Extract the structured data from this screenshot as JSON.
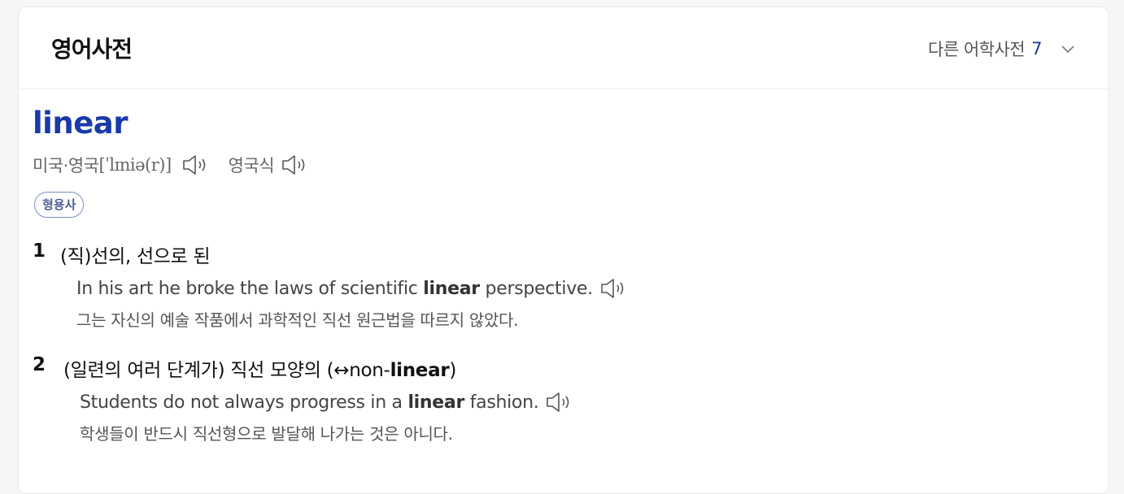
{
  "header": {
    "title": "영어사전",
    "other_dict_label": "다른 어학사전",
    "other_dict_count": "7"
  },
  "entry": {
    "word": "linear",
    "pron_label": "미국·영국",
    "ipa": "[ˈlɪniə(r)]",
    "variant_label": "영국식",
    "pos": "형용사",
    "senses": [
      {
        "num": "1",
        "definition": "(직)선의, 선으로 된",
        "example_before": "In his art he broke the laws of scientific ",
        "example_bold": "linear",
        "example_after": " perspective.",
        "translation": "그는 자신의 예술 작품에서 과학적인 직선 원근법을 따르지 않았다."
      },
      {
        "num": "2",
        "definition_before": "(일련의 여러 단계가) 직선 모양의 (↔non-",
        "definition_bold": "linear",
        "definition_after": ")",
        "example_before": "Students do not always progress in a ",
        "example_bold": "linear",
        "example_after": " fashion.",
        "translation": "학생들이 반드시 직선형으로 발달해 나가는 것은 아니다."
      }
    ]
  },
  "colors": {
    "headword": "#1a3aa8",
    "count": "#1a3a8f",
    "pos_border": "#7d8fbf"
  },
  "icons": [
    "chevron-down-icon",
    "speaker-icon"
  ]
}
